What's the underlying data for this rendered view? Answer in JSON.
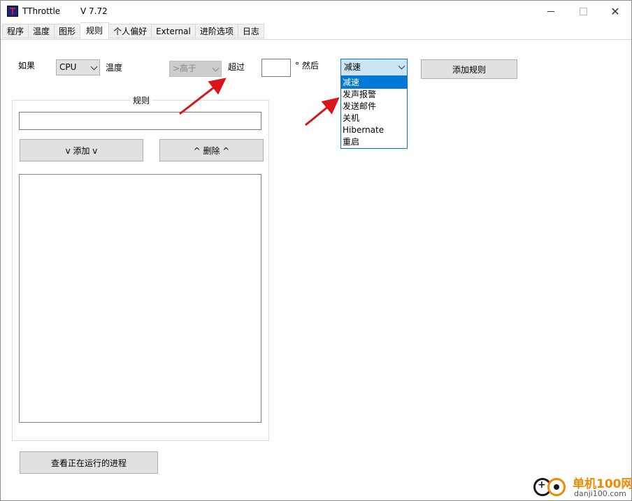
{
  "window": {
    "title": "TThrottle",
    "version": "V 7.72"
  },
  "tabs": [
    {
      "label": "程序"
    },
    {
      "label": "温度"
    },
    {
      "label": "图形"
    },
    {
      "label": "规则",
      "active": true
    },
    {
      "label": "个人偏好"
    },
    {
      "label": "External"
    },
    {
      "label": "进阶选项"
    },
    {
      "label": "日志"
    }
  ],
  "rule_builder": {
    "if_label": "如果",
    "source_select": "CPU",
    "temperature_label": "温度",
    "comparison_select": ">高于",
    "exceed_label": "超过",
    "threshold_value": "",
    "degree_then_label": "° 然后",
    "action_select": "减速",
    "add_rule_button": "添加规则"
  },
  "action_dropdown": {
    "options": [
      "减速",
      "发声报警",
      "发送邮件",
      "关机",
      "Hibernate",
      "重启"
    ],
    "selected_index": 0
  },
  "rules_group": {
    "title": "规则",
    "rule_input_value": "",
    "add_button": "v 添加 v",
    "delete_button": "^ 删除 ^",
    "rules_list": []
  },
  "footer": {
    "view_processes_button": "查看正在运行的进程"
  },
  "watermark": {
    "brand": "单机100网",
    "domain": "danji100.com"
  },
  "colors": {
    "selection": "#0078d7",
    "annotation_arrow": "#d9141b",
    "watermark_orange": "#f08a00"
  }
}
